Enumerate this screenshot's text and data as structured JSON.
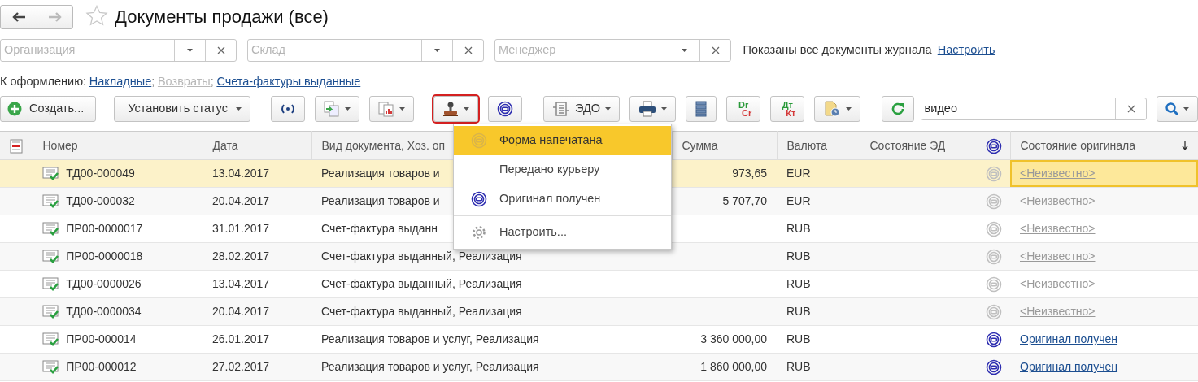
{
  "nav": {
    "back_enabled": true,
    "forward_enabled": false
  },
  "title": "Документы продажи (все)",
  "favorite": false,
  "filters": [
    {
      "placeholder": "Организация"
    },
    {
      "placeholder": "Склад"
    },
    {
      "placeholder": "Менеджер"
    }
  ],
  "filter_note": "Показаны все документы журнала",
  "filter_link": "Настроить",
  "todo": {
    "label": "К оформлению:",
    "items": [
      {
        "kind": "link",
        "text": "Накладные",
        "disabled": false
      },
      {
        "kind": "text",
        "text": ";"
      },
      {
        "kind": "link",
        "text": "Возвраты",
        "disabled": true
      },
      {
        "kind": "text",
        "text": ";"
      },
      {
        "kind": "link",
        "text": "Счета-фактуры выданные",
        "disabled": false
      }
    ]
  },
  "toolbar": [
    [
      {
        "kind": "create",
        "label": "Создать..."
      }
    ],
    [
      {
        "kind": "text",
        "label": "Установить статус",
        "dropdown": true
      }
    ],
    [
      {
        "kind": "broadcast"
      },
      {
        "kind": "copy",
        "dropdown": true
      },
      {
        "kind": "report",
        "dropdown": true
      }
    ],
    [
      {
        "kind": "stamp",
        "dropdown": true,
        "expanded": true
      },
      {
        "kind": "status"
      }
    ],
    [
      {
        "kind": "edo",
        "label": "ЭДО",
        "dropdown": true
      },
      {
        "kind": "print",
        "dropdown": true
      },
      {
        "kind": "list"
      },
      {
        "kind": "dual",
        "top": "Dr",
        "bottom": "Cr"
      },
      {
        "kind": "dual",
        "top": "Дт",
        "bottom": "Кт"
      },
      {
        "kind": "doc-clock",
        "dropdown": true
      }
    ],
    [
      {
        "kind": "refresh"
      }
    ]
  ],
  "search": {
    "value": "видео"
  },
  "menu": {
    "items": [
      {
        "kind": "printed",
        "text": "Форма напечатана",
        "selected": true
      },
      {
        "kind": "plain",
        "text": "Передано курьеру",
        "selected": false
      },
      {
        "kind": "received",
        "text": "Оригинал получен",
        "selected": false
      },
      {
        "kind": "separator"
      },
      {
        "kind": "settings",
        "text": "Настроить...",
        "selected": false
      }
    ]
  },
  "table": {
    "columns": [
      {
        "kind": "doc-icon"
      },
      {
        "kind": "text",
        "label": "Номер"
      },
      {
        "kind": "text",
        "label": "Дата"
      },
      {
        "kind": "text",
        "label": "Вид документа, Хоз. оп"
      },
      {
        "kind": "text",
        "label": "Сумма"
      },
      {
        "kind": "text",
        "label": "Валюта"
      },
      {
        "kind": "text",
        "label": "Состояние ЭД"
      },
      {
        "kind": "status-icon"
      },
      {
        "kind": "text",
        "label": "Состояние оригинала",
        "sorted_descending": true
      }
    ],
    "rows": [
      {
        "number": "ТД00-000049",
        "date": "13.04.2017",
        "type": "Реализация товаров и",
        "sum": "973,65",
        "currency": "EUR",
        "original_received": false,
        "original": "<Неизвестно>",
        "selected": true
      },
      {
        "number": "ТД00-000032",
        "date": "20.04.2017",
        "type": "Реализация товаров и",
        "sum": "5 707,70",
        "currency": "EUR",
        "original_received": false,
        "original": "<Неизвестно>",
        "selected": false
      },
      {
        "number": "ПР00-0000017",
        "date": "31.01.2017",
        "type": "Счет-фактура выданн",
        "currency": "RUB",
        "original_received": false,
        "original": "<Неизвестно>",
        "selected": false
      },
      {
        "number": "ПР00-0000018",
        "date": "28.02.2017",
        "type": "Счет-фактура выданный, Реализация",
        "currency": "RUB",
        "original_received": false,
        "original": "<Неизвестно>",
        "selected": false
      },
      {
        "number": "ТД00-0000026",
        "date": "13.04.2017",
        "type": "Счет-фактура выданный, Реализация",
        "currency": "RUB",
        "original_received": false,
        "original": "<Неизвестно>",
        "selected": false
      },
      {
        "number": "ТД00-0000034",
        "date": "20.04.2017",
        "type": "Счет-фактура выданный, Реализация",
        "currency": "RUB",
        "original_received": false,
        "original": "<Неизвестно>",
        "selected": false
      },
      {
        "number": "ПР00-000014",
        "date": "26.01.2017",
        "type": "Реализация товаров и услуг, Реализация",
        "sum": "3 360 000,00",
        "currency": "RUB",
        "original_received": true,
        "original": "Оригинал получен",
        "selected": false
      },
      {
        "number": "ПР00-000012",
        "date": "27.02.2017",
        "type": "Реализация товаров и услуг, Реализация",
        "sum": "1 860 000,00",
        "currency": "RUB",
        "original_received": true,
        "original": "Оригинал получен",
        "selected": false
      }
    ]
  }
}
